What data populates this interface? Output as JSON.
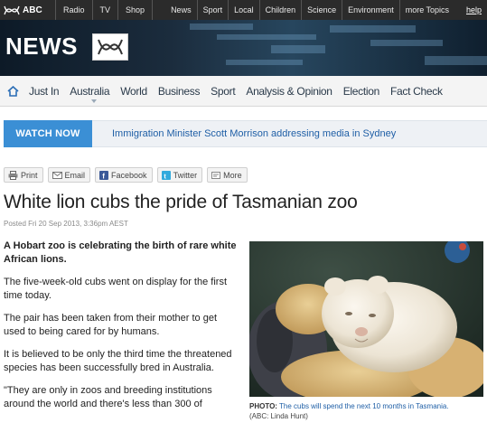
{
  "topbar": {
    "brand": "ABC",
    "links": [
      "Radio",
      "TV",
      "Shop"
    ],
    "right_links": [
      "News",
      "Sport",
      "Local",
      "Children",
      "Science",
      "Environment",
      "more Topics"
    ],
    "help": "help"
  },
  "banner": {
    "title": "NEWS"
  },
  "nav": {
    "items": [
      "Just In",
      "Australia",
      "World",
      "Business",
      "Sport",
      "Analysis & Opinion",
      "Election",
      "Fact Check"
    ]
  },
  "watch": {
    "button": "WATCH NOW",
    "link": "Immigration Minister Scott Morrison addressing media in Sydney"
  },
  "share": {
    "print": "Print",
    "email": "Email",
    "facebook": "Facebook",
    "twitter": "Twitter",
    "more": "More"
  },
  "article": {
    "headline": "White lion cubs the pride of Tasmanian zoo",
    "posted": "Posted Fri 20 Sep 2013, 3:36pm AEST",
    "paragraphs": [
      "A Hobart zoo is celebrating the birth of rare white African lions.",
      "The five-week-old cubs went on display for the first time today.",
      "The pair has been taken from their mother to get used to being cared for by humans.",
      "It is believed to be only the third time the threatened species has been successfully bred in Australia.",
      "\"They are only in zoos and breeding institutions around the world and there's less than 300 of"
    ]
  },
  "photo": {
    "label": "PHOTO:",
    "caption": "The cubs will spend the next 10 months in Tasmania.",
    "credit": "(ABC: Linda Hunt)"
  },
  "colors": {
    "topbar": "#2b2b2b",
    "watch_button": "#3b8fd5",
    "link": "#1f5fa6"
  }
}
